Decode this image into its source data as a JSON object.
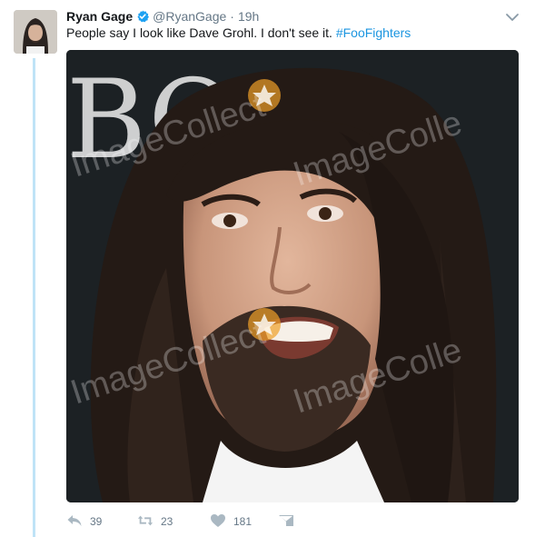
{
  "tweet": {
    "display_name": "Ryan Gage",
    "handle": "@RyanGage",
    "separator": "·",
    "time": "19h",
    "text_plain": "People say I look like Dave Grohl. I don't see it. ",
    "hashtag": "#FooFighters",
    "verified": true
  },
  "media": {
    "watermark_lines": [
      "ImageCollect",
      "ImageColle",
      "ImageCollect",
      "ImageColle"
    ],
    "backdrop_text": "BO T"
  },
  "actions": {
    "reply_count": "39",
    "retweet_count": "23",
    "like_count": "181"
  },
  "icons": {
    "verified": "verified-badge-icon",
    "menu": "chevron-down-icon",
    "reply": "reply-icon",
    "retweet": "retweet-icon",
    "like": "heart-icon",
    "dm": "direct-message-icon"
  },
  "colors": {
    "link": "#1b95e0",
    "muted": "#657786",
    "thread_line": "#bfe3f7",
    "text": "#14171a"
  }
}
